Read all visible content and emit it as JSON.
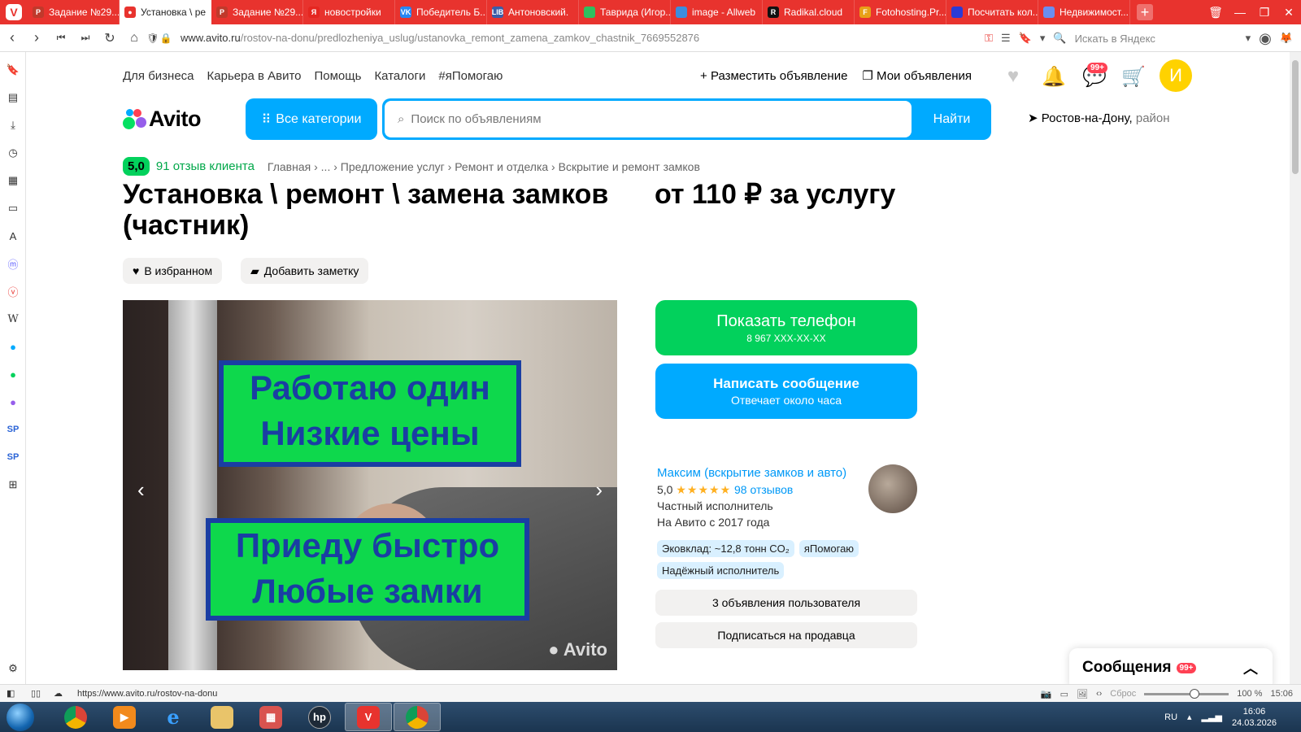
{
  "browser": {
    "tabs": [
      {
        "label": "Задание №29...",
        "icon_color": "#c0392b",
        "icon_text": "P"
      },
      {
        "label": "Установка \\ ре",
        "icon_color": "#e8332e",
        "icon_text": "●",
        "active": true
      },
      {
        "label": "Задание №29...",
        "icon_color": "#c0392b",
        "icon_text": "P"
      },
      {
        "label": "новостройки",
        "icon_color": "#e52620",
        "icon_text": "Я"
      },
      {
        "label": "Победитель Б...",
        "icon_color": "#2787f5",
        "icon_text": "VK"
      },
      {
        "label": "Антоновский.",
        "icon_color": "#3a5da8",
        "icon_text": "LIB"
      },
      {
        "label": "Таврида (Игор...",
        "icon_color": "#2fbf5f",
        "icon_text": ""
      },
      {
        "label": "image - Allweb",
        "icon_color": "#3c8dde",
        "icon_text": ""
      },
      {
        "label": "Radikal.cloud",
        "icon_color": "#111111",
        "icon_text": "R"
      },
      {
        "label": "Fotohosting.Pr...",
        "icon_color": "#e8a117",
        "icon_text": "F"
      },
      {
        "label": "Посчитать кол...",
        "icon_color": "#2a3bd6",
        "icon_text": ""
      },
      {
        "label": "Недвижимост...",
        "icon_color": "#6b8ef0",
        "icon_text": ""
      }
    ],
    "url_host": "www.avito.ru",
    "url_path": "/rostov-na-donu/predlozheniya_uslug/ustanovka_remont_zamena_zamkov_chastnik_7669552876",
    "yandex_search_placeholder": "Искать в Яндекс",
    "status_url": "https://www.avito.ru/rostov-na-donu",
    "zoom_reset_label": "Сброс",
    "zoom_level": "100 %",
    "status_time": "15:06"
  },
  "topnav": {
    "left": [
      "Для бизнеса",
      "Карьера в Авито",
      "Помощь",
      "Каталоги",
      "#яПомогаю"
    ],
    "post_ad": "Разместить объявление",
    "my_ads": "Мои объявления",
    "messages_badge": "99+",
    "avatar_letter": "И"
  },
  "header": {
    "logo": "Avito",
    "all_categories": "Все категории",
    "search_placeholder": "Поиск по объявлениям",
    "search_button": "Найти",
    "location_city": "Ростов-на-Дону,",
    "location_district": "район"
  },
  "listing": {
    "rating": "5,0",
    "reviews_link": "91 отзыв клиента",
    "breadcrumbs": [
      "Главная",
      "...",
      "Предложение услуг",
      "Ремонт и отделка",
      "Вскрытие и ремонт замков"
    ],
    "title": "Установка \\ ремонт \\ замена замков (частник)",
    "price": "от 110 ₽ за услугу",
    "favorite_button": "В избранном",
    "note_button": "Добавить заметку",
    "photo_text1": "Работаю один",
    "photo_text2": "Низкие цены",
    "photo_text3": "Приеду быстро",
    "photo_text4": "Любые замки",
    "photo_watermark": "Avito"
  },
  "contact": {
    "show_phone": "Показать телефон",
    "phone_masked": "8 967 XXX-XX-XX",
    "write_message": "Написать сообщение",
    "response_time": "Отвечает около часа"
  },
  "seller": {
    "name": "Максим (вскрытие замков и авто)",
    "rating": "5,0",
    "stars": "★★★★★",
    "reviews": "98 отзывов",
    "type": "Частный исполнитель",
    "since": "На Авито с 2017 года",
    "tags": [
      "Эковклад: ~12,8 тонн CO₂",
      "яПомогаю",
      "Надёжный исполнитель"
    ],
    "user_ads": "3 объявления пользователя",
    "subscribe": "Подписаться на продавца"
  },
  "messages_panel": {
    "title": "Сообщения",
    "badge": "99+"
  },
  "taskbar": {
    "lang": "RU",
    "time": "16:06",
    "date": "24.03.2026"
  }
}
